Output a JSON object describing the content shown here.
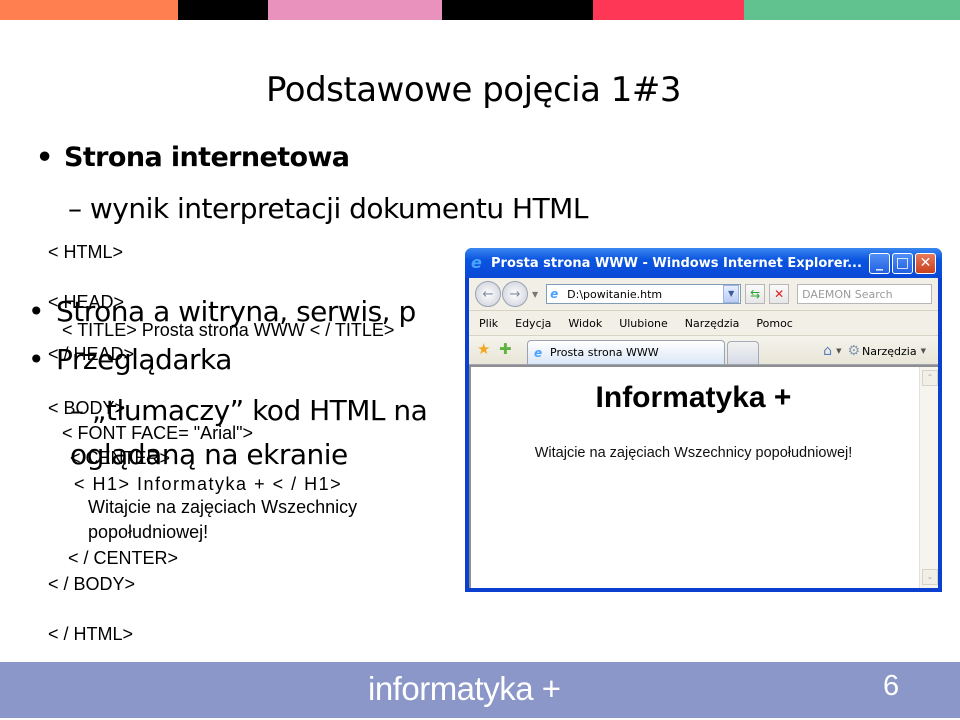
{
  "top_bar": {
    "colors": [
      "#ff7f50",
      "#000000",
      "#e992be",
      "#000000",
      "#ff3756",
      "#62c28f"
    ]
  },
  "slide": {
    "title": "Podstawowe pojęcia 1#3",
    "bullets": [
      {
        "text": "Strona internetowa",
        "bold": true,
        "sub": [
          "– wynik interpretacji dokumentu HTML"
        ]
      },
      {
        "text": "Strona a witryna, serwis, p",
        "bold": false,
        "sub": []
      },
      {
        "text": "Przeglądarka",
        "bold": false,
        "sub": [
          "– „tłumaczy” kod HTML na",
          "oglądaną na ekranie"
        ]
      }
    ],
    "bullet_glyph": "•"
  },
  "code": {
    "html_open": "< HTML>",
    "head_open": "< HEAD>",
    "title_line": "< TITLE>  Prosta strona WWW  < / TITLE>",
    "head_close": "< / HEAD>",
    "body_open": "< BODY>",
    "font_line": "< FONT  FACE= \"Arial\">",
    "center_open": "< CENTER>",
    "h1_line": "< H1> Informatyka + < / H1>",
    "text_line1": "Witajcie na zajęciach Wszechnicy",
    "text_line2": "popołudniowej!",
    "center_close": "< / CENTER>",
    "body_close": "< / BODY>",
    "html_close": "< / HTML>"
  },
  "browser": {
    "window_title": "Prosta strona WWW - Windows Internet Explorer...",
    "address": "D:\\powitanie.htm",
    "search_placeholder": "DAEMON Search",
    "menu": [
      "Plik",
      "Edycja",
      "Widok",
      "Ulubione",
      "Narzędzia",
      "Pomoc"
    ],
    "tab_label": "Prosta strona WWW",
    "tools_label": "Narzędzia",
    "page_heading": "Informatyka +",
    "page_text": "Witajcie na zajęciach Wszechnicy popołudniowej!",
    "icons": {
      "ie": "e",
      "back": "←",
      "forward": "→",
      "dropdown": "▼",
      "refresh": "⇆",
      "stop": "✕",
      "star": "★",
      "add_fav": "✚",
      "home": "⌂",
      "gear": "⚙",
      "minimize": "_",
      "maximize": "□",
      "close": "✕",
      "scroll_up": "⌃",
      "scroll_down": "⌄"
    }
  },
  "footer": {
    "title": "informatyka +",
    "page_number": "6",
    "color": "#8b96c9"
  }
}
